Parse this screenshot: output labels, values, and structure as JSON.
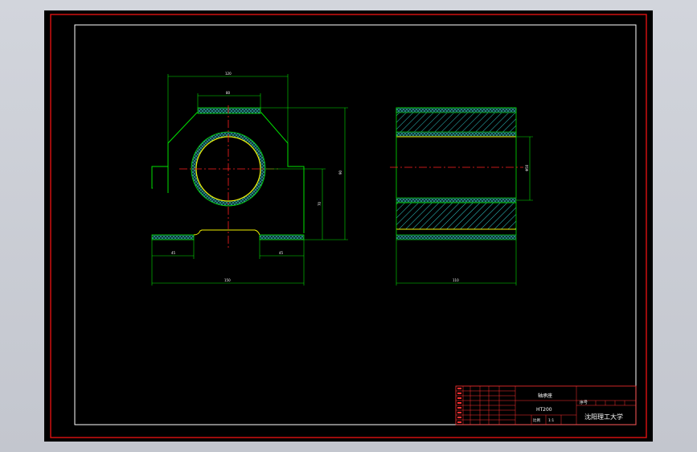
{
  "drawing": {
    "colors": {
      "background": "#000000",
      "frame": "#d01010",
      "border": "#ffffff",
      "outline": "#00e000",
      "hatch": "#30c8c8",
      "bearing": "#f0f000",
      "centerline": "#ff2020",
      "dimension": "#ffffff",
      "titleblock_lines": "#ff3030"
    },
    "dimensions": {
      "top_width": "120",
      "top_recess": "80",
      "height_total": "90",
      "center_height": "70",
      "foot_left": "45",
      "foot_right": "45",
      "base_width": "150",
      "side_bore": "Φ50",
      "side_length": "110"
    }
  },
  "title_block": {
    "part_name": "轴承座",
    "material": "HT200",
    "scale_label": "比例",
    "scale_value": "1:1",
    "sheet_label": "序号",
    "school": "沈阳理工大学"
  }
}
